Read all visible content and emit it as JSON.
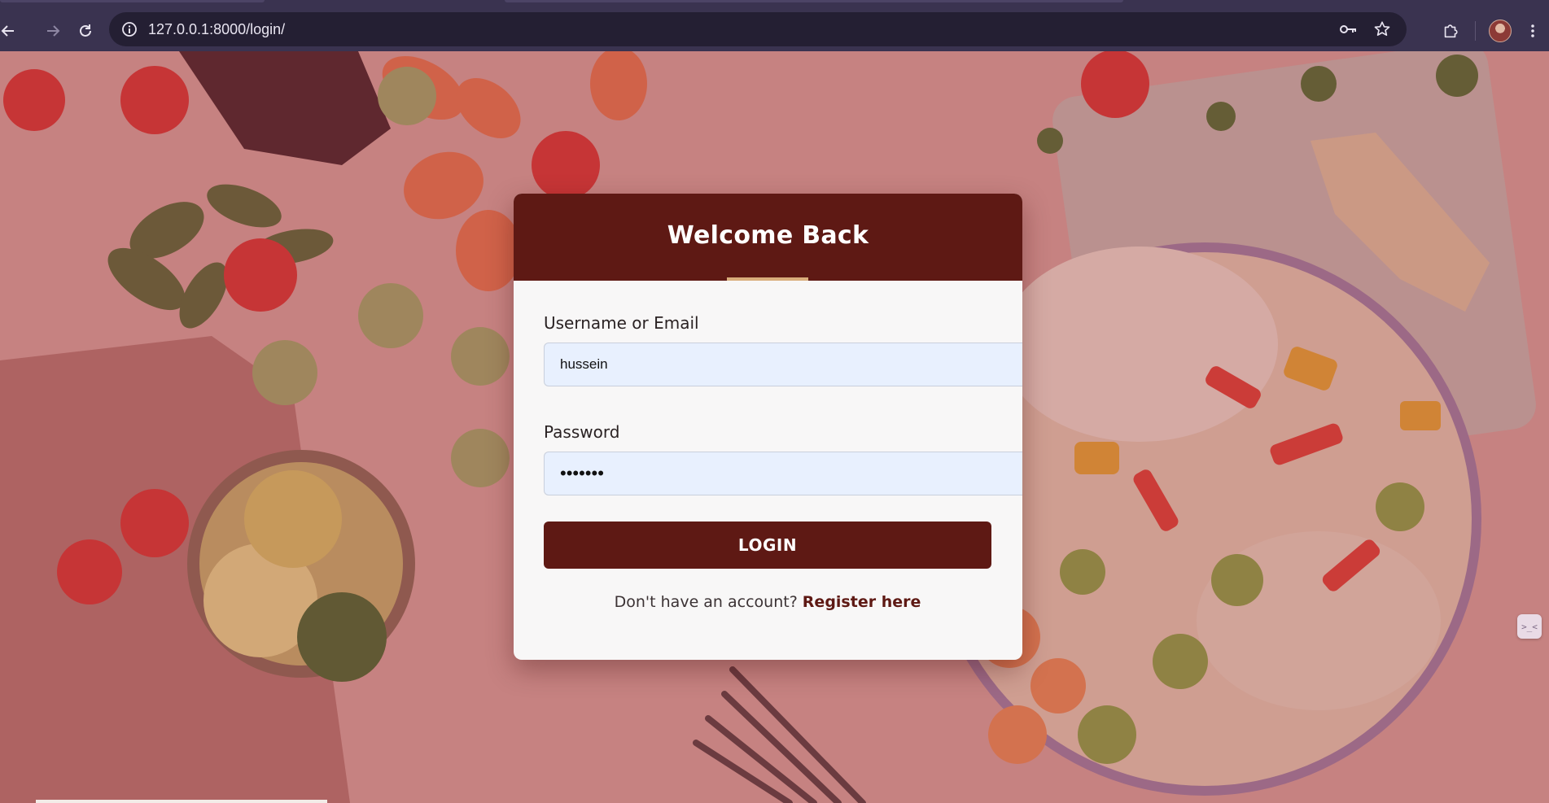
{
  "browser": {
    "url": "127.0.0.1:8000/login/",
    "icons": {
      "back": "arrow-left-icon",
      "forward": "arrow-right-icon",
      "reload": "reload-icon",
      "site_info": "info-icon",
      "password": "key-icon",
      "bookmark": "star-icon",
      "extensions": "puzzle-icon",
      "menu": "kebab-menu-icon"
    }
  },
  "login": {
    "title": "Welcome Back",
    "username_label": "Username or Email",
    "username_value": "hussein",
    "password_label": "Password",
    "password_value": "•••••••",
    "login_button": "LOGIN",
    "register_prompt": "Don't have an account?",
    "register_link": "Register here"
  },
  "side_widget": {
    "icon": ">_<"
  },
  "colors": {
    "brand": "#5e1914",
    "accent": "#d9ad7c",
    "field_bg": "#e8f0fe",
    "card_bg": "#f8f7f7",
    "chrome_bg": "#3a3350"
  }
}
